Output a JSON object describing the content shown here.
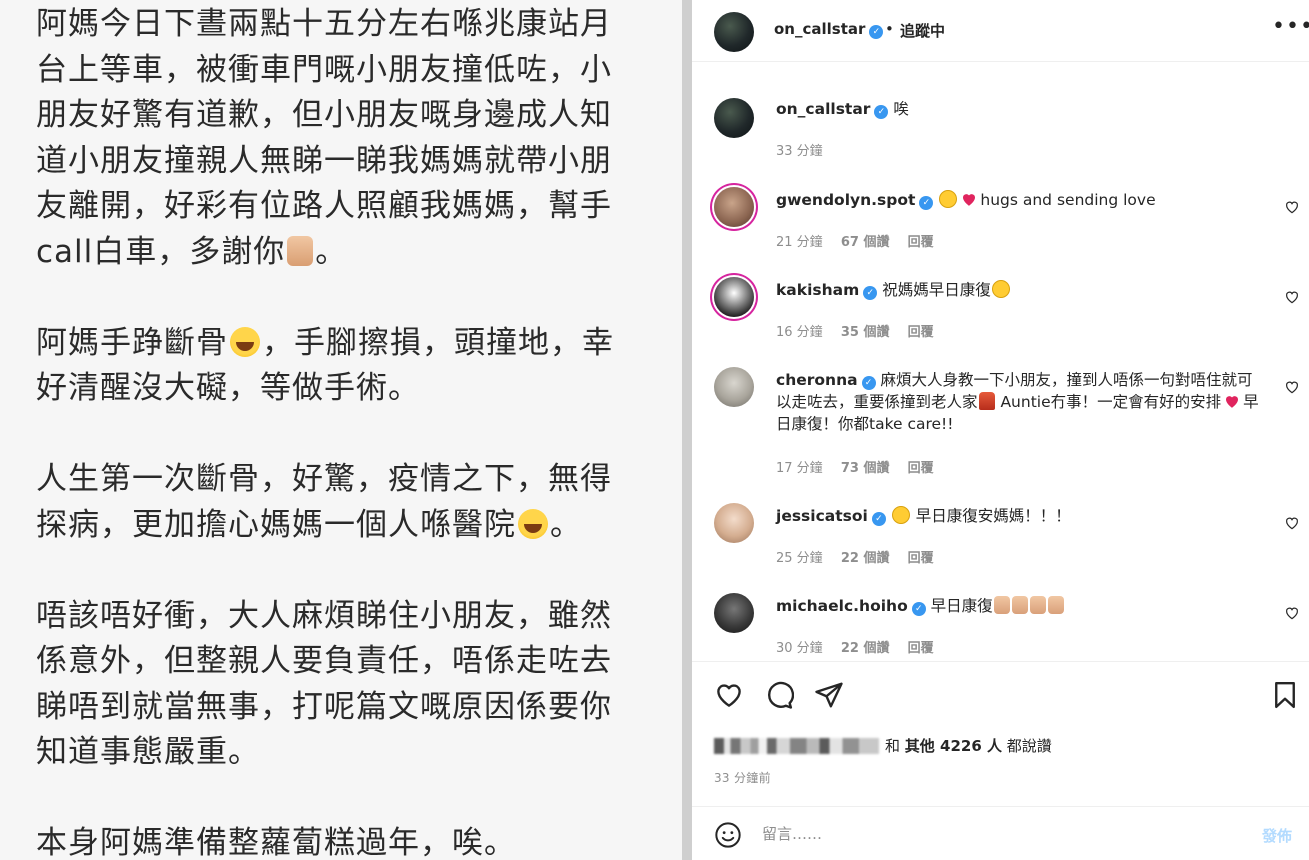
{
  "post_image": {
    "paragraphs": [
      [
        "阿媽今日下晝兩點十五分左右喺兆康站月",
        "台上等車，被衝車門嘅小朋友撞低咗，小",
        "朋友好驚有道歉，但小朋友嘅身邊成人知",
        "道小朋友撞親人無睇一睇我媽媽就帶小朋",
        "友離開，好彩有位路人照顧我媽媽，幫手"
      ],
      [
        "阿媽手踭斷骨",
        "，手腳擦損，頭撞地，幸",
        "好清醒沒大礙，等做手術。"
      ],
      [
        "人生第一次斷骨，好驚，疫情之下，無得",
        "探病，更加擔心媽媽一個人喺醫院",
        "。"
      ],
      [
        "唔該唔好衝，大人麻煩睇住小朋友，雖然",
        "係意外，但整親人要負責任，唔係走咗去",
        "睇唔到就當無事，打呢篇文嘅原因係要你",
        "知道事態嚴重。"
      ],
      [
        "本身阿媽準備整蘿蔔糕過年，唉。"
      ]
    ],
    "line6_text": "call白車，多謝你",
    "line6_end": "。"
  },
  "header": {
    "username": "on_callstar",
    "separator": "•",
    "follow_label": "追蹤中",
    "more_label": "•••"
  },
  "caption": {
    "username": "on_callstar",
    "text": "唉",
    "time": "33 分鐘"
  },
  "comments": [
    {
      "username": "gwendolyn.spot",
      "text": "hugs and sending love",
      "time": "21 分鐘",
      "likes": "67 個讚",
      "reply": "回覆"
    },
    {
      "username": "kakisham",
      "text": "祝媽媽早日康復",
      "time": "16 分鐘",
      "likes": "35 個讚",
      "reply": "回覆"
    },
    {
      "username": "cheronna",
      "text_a": "麻煩大人身教一下小朋友，撞到人唔係一句對唔住就可以走咗去，重要係撞到老人家",
      "text_b": " Auntie冇事！一定會有好的安排",
      "text_c": "早日康復！你都take care!!",
      "time": "17 分鐘",
      "likes": "73 個讚",
      "reply": "回覆"
    },
    {
      "username": "jessicatsoi",
      "text": " 早日康復安媽媽！！！",
      "time": "25 分鐘",
      "likes": "22 個讚",
      "reply": "回覆"
    },
    {
      "username": "michaelc.hoiho",
      "text": "早日康復",
      "time": "30 分鐘",
      "likes": "22 個讚",
      "reply": "回覆"
    }
  ],
  "likes_summary": {
    "and_label": "和",
    "others_label": "其他 4226 人",
    "suffix": "都說讚"
  },
  "post_time": "33 分鐘前",
  "comment_input": {
    "placeholder": "留言……",
    "post_label": "發佈"
  },
  "colors": {
    "verified": "#3897f0",
    "story_ring": "#d6249f",
    "muted": "#8e8e8e",
    "post_disabled": "#b3dbff"
  }
}
